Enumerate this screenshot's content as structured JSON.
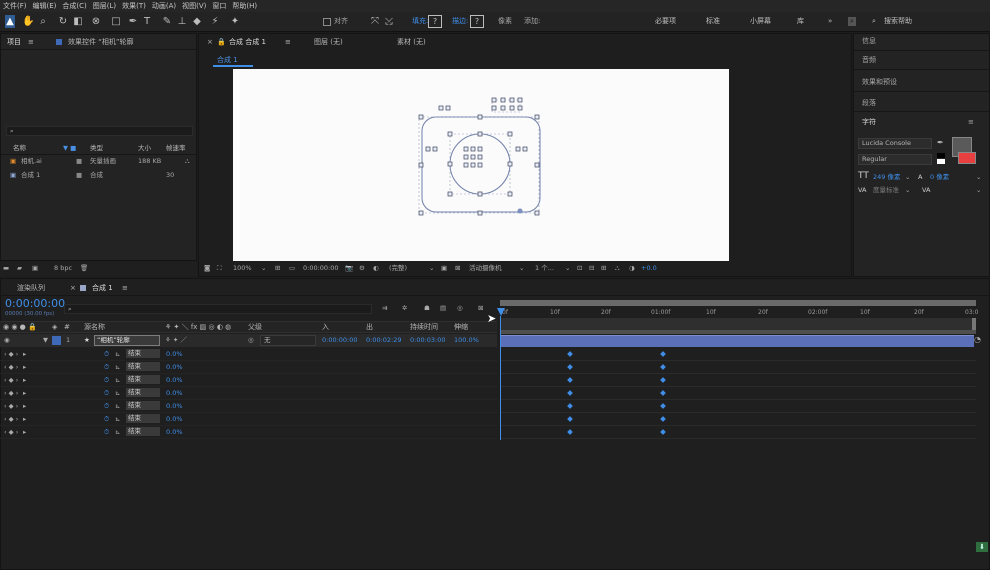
{
  "menu": [
    "文件(F)",
    "编辑(E)",
    "合成(C)",
    "图层(L)",
    "效果(T)",
    "动画(A)",
    "视图(V)",
    "窗口",
    "帮助(H)"
  ],
  "toolbar": {
    "align_label": "对齐",
    "fill_label": "填充:",
    "fill_value": "?",
    "stroke_label": "描边:",
    "stroke_value": "?",
    "px_label": "像素",
    "add_label": "添加:"
  },
  "workspaces": [
    "必要项",
    "标准",
    "小屏幕",
    "库"
  ],
  "search_help_placeholder": "搜索帮助",
  "project_panel": {
    "tab_project": "项目",
    "tab_effects": "效果控件 “相机”轮廓",
    "columns": [
      "名称",
      "类型",
      "大小",
      "帧速率"
    ],
    "items": [
      {
        "name": "相机.ai",
        "type": "矢量插画",
        "size": "188 KB",
        "fps": ""
      },
      {
        "name": "合成 1",
        "type": "合成",
        "size": "",
        "fps": "30"
      }
    ],
    "bpc": "8 bpc"
  },
  "comp_panel": {
    "tab_comp": "合成 合成 1",
    "tab_layer": "图层 (无)",
    "tab_footage": "素材 (无)",
    "subtab": "合成 1",
    "zoom": "100%",
    "timecode": "0:00:00:00",
    "quality": "(完整)",
    "camera": "活动摄像机",
    "views": "1 个...",
    "exposure": "+0.0"
  },
  "right_panels": [
    "信息",
    "音频",
    "效果和预设",
    "段落",
    "字符"
  ],
  "character": {
    "font": "Lucida Console",
    "style": "Regular",
    "size": "249 像素",
    "leading": "0 像素",
    "tracking_label": "度量标准"
  },
  "timeline": {
    "tab_render": "渲染队列",
    "tab_comp": "合成 1",
    "current_time": "0:00:00:00",
    "fps_info": "00000 (30.00 fps)",
    "columns": {
      "name": "源名称",
      "parent": "父级",
      "in": "入",
      "out": "出",
      "duration": "持续时间",
      "stretch": "伸缩"
    },
    "layer": {
      "index": "1",
      "name": "“相机”轮廓",
      "parent": "无",
      "in": "0:00:00:00",
      "out": "0:00:02:29",
      "duration": "0:00:03:00",
      "stretch": "100.0%"
    },
    "props": [
      {
        "label": "结束",
        "value": "0.0%"
      },
      {
        "label": "结束",
        "value": "0.0%"
      },
      {
        "label": "结束",
        "value": "0.0%"
      },
      {
        "label": "结束",
        "value": "0.0%"
      },
      {
        "label": "结束",
        "value": "0.0%"
      },
      {
        "label": "结束",
        "value": "0.0%"
      },
      {
        "label": "结束",
        "value": "0.0%"
      }
    ],
    "ruler": [
      "0f",
      "10f",
      "20f",
      "01:00f",
      "10f",
      "20f",
      "02:00f",
      "10f",
      "20f",
      "03:0"
    ]
  },
  "colors": {
    "accent": "#3f8ee8",
    "layer_bar": "#5a6fb8",
    "panel": "#232323",
    "background": "#1d1d1d"
  }
}
